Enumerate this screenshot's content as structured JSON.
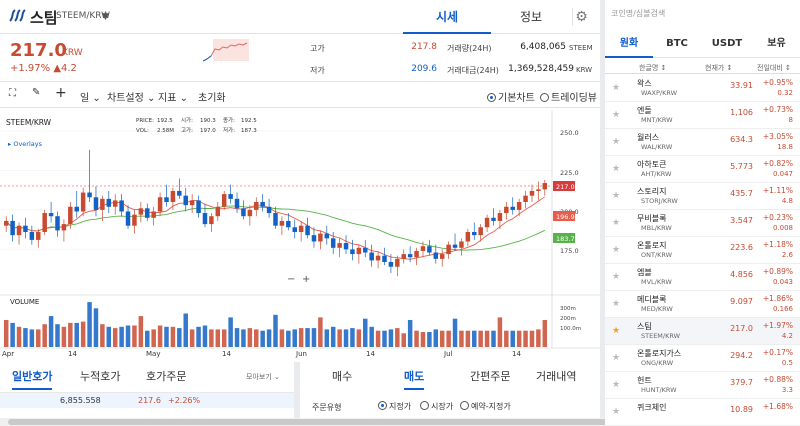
{
  "header": {
    "coin_name": "스팀",
    "pair": "STEEM/KRW",
    "tabs": [
      "시세",
      "정보"
    ]
  },
  "summary": {
    "price": "217.0",
    "unit": "KRW",
    "change": "+1.97% ▲4.2",
    "high_label": "고가",
    "high": "217.8",
    "low_label": "저가",
    "low": "209.6",
    "vol_label": "거래량(24H)",
    "vol": "6,408,065",
    "vol_unit": "STEEM",
    "amt_label": "거래대금(24H)",
    "amt": "1,369,528,459",
    "amt_unit": "KRW"
  },
  "toolbar": {
    "period": "일",
    "chart_settings": "차트설정",
    "indicator": "지표",
    "reset": "초기화",
    "basic_chart": "기본차트",
    "trading_view": "트레이딩뷰"
  },
  "chart": {
    "pair_label": "STEEM/KRW",
    "overlays": "Overlays",
    "ohlc": {
      "price_lbl": "PRICE:",
      "price": "192.5",
      "open_lbl": "시가:",
      "open": "190.3",
      "close_lbl": "종가:",
      "close": "192.5",
      "vol_lbl": "VOL:",
      "vol": "2.58M",
      "high_lbl": "고가:",
      "high": "197.0",
      "low_lbl": "저가:",
      "low": "187.3"
    },
    "y_ticks": [
      "250.0",
      "225.0",
      "200.0",
      "175.0"
    ],
    "vol_ticks": [
      "300m",
      "200m",
      "100.0m"
    ],
    "x_ticks": [
      "Apr",
      "14",
      "May",
      "14",
      "Jun",
      "14",
      "Jul",
      "14"
    ],
    "volume_label": "VOLUME",
    "price_tags": {
      "last": "217.0",
      "ma_short": "196.9",
      "ma_long": "183.7"
    },
    "zoom_minus": "−",
    "zoom_plus": "+"
  },
  "chart_data": {
    "type": "candlestick",
    "xlabel": "",
    "ylabel": "",
    "ylim": [
      148,
      262
    ],
    "candles": [
      [
        190,
        196,
        186,
        193
      ],
      [
        193,
        197,
        180,
        184
      ],
      [
        184,
        192,
        178,
        190
      ],
      [
        190,
        195,
        182,
        186
      ],
      [
        186,
        190,
        178,
        181
      ],
      [
        181,
        188,
        176,
        186
      ],
      [
        186,
        200,
        184,
        198
      ],
      [
        198,
        205,
        192,
        196
      ],
      [
        196,
        199,
        183,
        187
      ],
      [
        187,
        194,
        180,
        191
      ],
      [
        191,
        205,
        188,
        202
      ],
      [
        202,
        212,
        195,
        199
      ],
      [
        199,
        214,
        196,
        211
      ],
      [
        211,
        238,
        205,
        208
      ],
      [
        208,
        215,
        196,
        200
      ],
      [
        200,
        209,
        193,
        207
      ],
      [
        207,
        212,
        198,
        202
      ],
      [
        202,
        210,
        197,
        206
      ],
      [
        206,
        210,
        196,
        199
      ],
      [
        199,
        203,
        188,
        190
      ],
      [
        190,
        200,
        185,
        197
      ],
      [
        197,
        205,
        192,
        201
      ],
      [
        201,
        204,
        193,
        195
      ],
      [
        195,
        202,
        190,
        199
      ],
      [
        199,
        211,
        196,
        208
      ],
      [
        208,
        216,
        202,
        205
      ],
      [
        205,
        214,
        200,
        212
      ],
      [
        212,
        220,
        207,
        209
      ],
      [
        209,
        214,
        199,
        203
      ],
      [
        203,
        210,
        198,
        206
      ],
      [
        206,
        209,
        195,
        198
      ],
      [
        198,
        204,
        189,
        191
      ],
      [
        191,
        198,
        186,
        196
      ],
      [
        196,
        205,
        193,
        202
      ],
      [
        202,
        212,
        200,
        210
      ],
      [
        210,
        216,
        204,
        207
      ],
      [
        207,
        211,
        198,
        201
      ],
      [
        201,
        206,
        194,
        196
      ],
      [
        196,
        203,
        190,
        200
      ],
      [
        200,
        208,
        196,
        205
      ],
      [
        205,
        210,
        199,
        202
      ],
      [
        202,
        207,
        195,
        198
      ],
      [
        198,
        202,
        188,
        190
      ],
      [
        190,
        196,
        184,
        193
      ],
      [
        193,
        198,
        187,
        189
      ],
      [
        189,
        194,
        182,
        186
      ],
      [
        186,
        193,
        180,
        190
      ],
      [
        190,
        195,
        182,
        184
      ],
      [
        184,
        189,
        176,
        180
      ],
      [
        180,
        187,
        175,
        185
      ],
      [
        185,
        190,
        178,
        182
      ],
      [
        182,
        186,
        172,
        176
      ],
      [
        176,
        182,
        170,
        179
      ],
      [
        179,
        184,
        172,
        175
      ],
      [
        175,
        181,
        168,
        172
      ],
      [
        172,
        178,
        166,
        176
      ],
      [
        176,
        181,
        170,
        173
      ],
      [
        173,
        178,
        164,
        168
      ],
      [
        168,
        174,
        163,
        171
      ],
      [
        171,
        176,
        165,
        167
      ],
      [
        167,
        172,
        160,
        164
      ],
      [
        164,
        171,
        158,
        169
      ],
      [
        169,
        175,
        166,
        172
      ],
      [
        172,
        177,
        167,
        170
      ],
      [
        170,
        176,
        165,
        174
      ],
      [
        174,
        180,
        170,
        177
      ],
      [
        177,
        181,
        171,
        173
      ],
      [
        173,
        178,
        166,
        169
      ],
      [
        169,
        175,
        164,
        172
      ],
      [
        172,
        180,
        169,
        178
      ],
      [
        178,
        185,
        174,
        176
      ],
      [
        176,
        182,
        171,
        180
      ],
      [
        180,
        188,
        177,
        186
      ],
      [
        186,
        192,
        181,
        184
      ],
      [
        184,
        191,
        180,
        189
      ],
      [
        189,
        197,
        186,
        195
      ],
      [
        195,
        201,
        190,
        193
      ],
      [
        193,
        200,
        188,
        198
      ],
      [
        198,
        205,
        194,
        202
      ],
      [
        202,
        208,
        197,
        200
      ],
      [
        200,
        207,
        196,
        205
      ],
      [
        205,
        212,
        201,
        209
      ],
      [
        209,
        216,
        205,
        212
      ],
      [
        212,
        218,
        206,
        213
      ],
      [
        213,
        219,
        209,
        217
      ]
    ],
    "ma_short_end": 196.9,
    "ma_long_end": 183.7,
    "last_price": 217.0
  },
  "orderbook": {
    "tabs": [
      "일반호가",
      "누적호가",
      "호가주문"
    ],
    "more": "모아보기",
    "row_qty": "6,855.558",
    "row_price": "217.6",
    "row_pct": "+2.26%"
  },
  "order": {
    "tabs": [
      "매수",
      "매도",
      "간편주문",
      "거래내역"
    ],
    "type_label": "주문유형",
    "types": [
      "지정가",
      "시장가",
      "예약-지정가"
    ]
  },
  "market": {
    "search_placeholder": "코인명/심볼검색",
    "tabs": [
      "원화",
      "BTC",
      "USDT",
      "보유"
    ],
    "col_name": "한글명 ↕",
    "col_price": "현재가 ↕",
    "col_change": "전일대비 ↕",
    "rows": [
      {
        "name": "왁스",
        "pair": "WAXP/KRW",
        "price": "33.91",
        "pct": "+0.95%",
        "amt": "0.32"
      },
      {
        "name": "엔돌",
        "pair": "MNT/KRW",
        "price": "1,106",
        "pct": "+0.73%",
        "amt": "8"
      },
      {
        "name": "월러스",
        "pair": "WAL/KRW",
        "price": "634.3",
        "pct": "+3.05%",
        "amt": "18.8"
      },
      {
        "name": "아하토큰",
        "pair": "AHT/KRW",
        "price": "5.773",
        "pct": "+0.82%",
        "amt": "0.047"
      },
      {
        "name": "스토리지",
        "pair": "STORJ/KRW",
        "price": "435.7",
        "pct": "+1.11%",
        "amt": "4.8"
      },
      {
        "name": "무비블록",
        "pair": "MBL/KRW",
        "price": "3.547",
        "pct": "+0.23%",
        "amt": "0.008"
      },
      {
        "name": "온톨로지",
        "pair": "ONT/KRW",
        "price": "223.6",
        "pct": "+1.18%",
        "amt": "2.6"
      },
      {
        "name": "엠블",
        "pair": "MVL/KRW",
        "price": "4.856",
        "pct": "+0.89%",
        "amt": "0.043"
      },
      {
        "name": "메디블록",
        "pair": "MED/KRW",
        "price": "9.097",
        "pct": "+1.86%",
        "amt": "0.166"
      },
      {
        "name": "스팀",
        "pair": "STEEM/KRW",
        "price": "217.0",
        "pct": "+1.97%",
        "amt": "4.2"
      },
      {
        "name": "온톨로지가스",
        "pair": "ONG/KRW",
        "price": "294.2",
        "pct": "+0.17%",
        "amt": "0.5"
      },
      {
        "name": "헌트",
        "pair": "HUNT/KRW",
        "price": "379.7",
        "pct": "+0.88%",
        "amt": "3.3"
      },
      {
        "name": "퀴크체인",
        "pair": "",
        "price": "10.89",
        "pct": "+1.68%",
        "amt": ""
      }
    ]
  },
  "colors": {
    "up": "#c84a31",
    "down": "#1261c4",
    "accent": "#115dcb",
    "ma_short": "#e85c4a",
    "ma_long": "#56b34a"
  }
}
